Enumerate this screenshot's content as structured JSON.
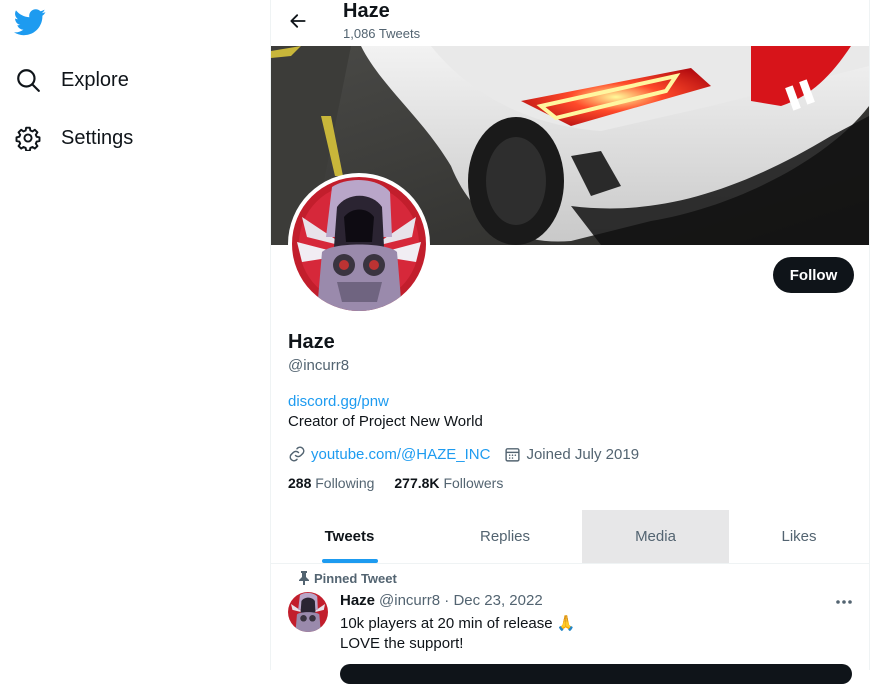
{
  "sidebar": {
    "logo_icon": "twitter-bird-icon",
    "items": [
      {
        "label": "Explore",
        "icon": "search-icon"
      },
      {
        "label": "Settings",
        "icon": "gear-icon"
      }
    ]
  },
  "topbar": {
    "name": "Haze",
    "tweet_count": "1,086 Tweets"
  },
  "profile": {
    "name": "Haze",
    "handle": "@incurr8",
    "bio_link": "discord.gg/pnw",
    "bio": "Creator of Project New World",
    "website": "youtube.com/@HAZE_INC",
    "joined": "Joined July 2019",
    "following_count": "288",
    "following_label": "Following",
    "followers_count": "277.8K",
    "followers_label": "Followers",
    "follow_label": "Follow"
  },
  "tabs": [
    "Tweets",
    "Replies",
    "Media",
    "Likes"
  ],
  "tweet": {
    "pinned_label": "Pinned Tweet",
    "author": "Haze",
    "handle_date": "@incurr8 · Dec 23, 2022",
    "line1": "10k players at 20 min of release 🙏",
    "line2": "LOVE the support!"
  },
  "colors": {
    "accent": "#1d9bf0",
    "text": "#0f1419",
    "muted": "#536471",
    "follow_bg": "#0f1419"
  }
}
